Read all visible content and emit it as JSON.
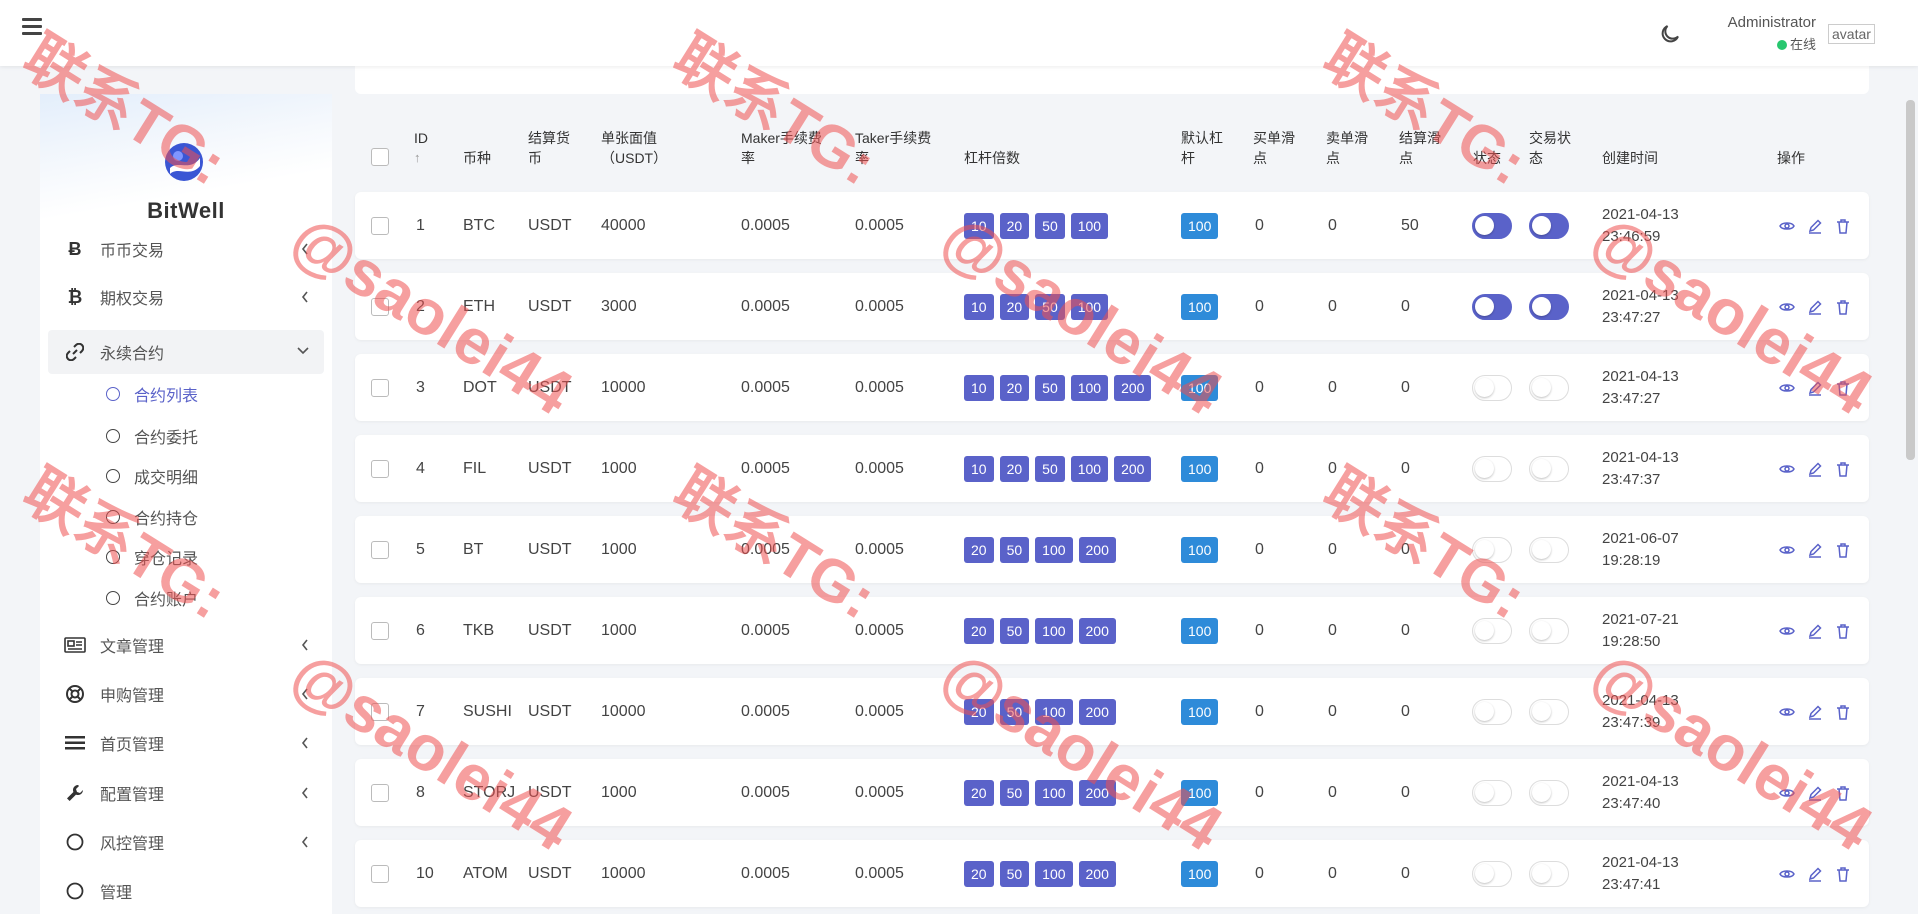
{
  "header": {
    "user_name": "Administrator",
    "user_status": "在线",
    "avatar_alt": "avatar"
  },
  "sidebar": {
    "brand": "BitWell",
    "items": [
      {
        "label": "币币交易",
        "icon": "bitcoin-icon",
        "top": 0
      },
      {
        "label": "期权交易",
        "icon": "bitcoin-icon"
      },
      {
        "label": "永续合约",
        "icon": "link-icon",
        "open": true
      },
      {
        "label": "文章管理",
        "icon": "newspaper-icon"
      },
      {
        "label": "申购管理",
        "icon": "lifebuoy-icon"
      },
      {
        "label": "首页管理",
        "icon": "list-icon"
      },
      {
        "label": "配置管理",
        "icon": "wrench-icon"
      },
      {
        "label": "风控管理",
        "icon": "circle-icon"
      },
      {
        "label": "管理",
        "icon": "circle-icon"
      }
    ],
    "sub_items": [
      "合约列表",
      "合约委托",
      "成交明细",
      "合约持仓",
      "穿仓记录",
      "合约账户"
    ]
  },
  "table": {
    "headers": {
      "id": "ID",
      "symbol": "币种",
      "settle": "结算货币",
      "face_value": "单张面值（USDT）",
      "maker": "Maker手续费率",
      "taker": "Taker手续费率",
      "leverage": "杠杆倍数",
      "default_leverage": "默认杠杆",
      "buy_slip": "买单滑点",
      "sell_slip": "卖单滑点",
      "settle_slip": "结算滑点",
      "status": "状态",
      "trade_status": "交易状态",
      "created": "创建时间",
      "ops": "操作"
    },
    "rows": [
      {
        "id": "1",
        "symbol": "BTC",
        "settle": "USDT",
        "face": "40000",
        "maker": "0.0005",
        "taker": "0.0005",
        "lev": [
          "10",
          "20",
          "50",
          "100"
        ],
        "def": "100",
        "buy": "0",
        "sell": "0",
        "settle_slip": "50",
        "status": true,
        "trade": true,
        "date": "2021-04-13",
        "time": "23:46:59"
      },
      {
        "id": "2",
        "symbol": "ETH",
        "settle": "USDT",
        "face": "3000",
        "maker": "0.0005",
        "taker": "0.0005",
        "lev": [
          "10",
          "20",
          "50",
          "100"
        ],
        "def": "100",
        "buy": "0",
        "sell": "0",
        "settle_slip": "0",
        "status": true,
        "trade": true,
        "date": "2021-04-13",
        "time": "23:47:27"
      },
      {
        "id": "3",
        "symbol": "DOT",
        "settle": "USDT",
        "face": "10000",
        "maker": "0.0005",
        "taker": "0.0005",
        "lev": [
          "10",
          "20",
          "50",
          "100",
          "200"
        ],
        "def": "100",
        "buy": "0",
        "sell": "0",
        "settle_slip": "0",
        "status": false,
        "trade": false,
        "date": "2021-04-13",
        "time": "23:47:27"
      },
      {
        "id": "4",
        "symbol": "FIL",
        "settle": "USDT",
        "face": "1000",
        "maker": "0.0005",
        "taker": "0.0005",
        "lev": [
          "10",
          "20",
          "50",
          "100",
          "200"
        ],
        "def": "100",
        "buy": "0",
        "sell": "0",
        "settle_slip": "0",
        "status": false,
        "trade": false,
        "date": "2021-04-13",
        "time": "23:47:37"
      },
      {
        "id": "5",
        "symbol": "BT",
        "settle": "USDT",
        "face": "1000",
        "maker": "0.0005",
        "taker": "0.0005",
        "lev": [
          "20",
          "50",
          "100",
          "200"
        ],
        "def": "100",
        "buy": "0",
        "sell": "0",
        "settle_slip": "0",
        "status": false,
        "trade": false,
        "date": "2021-06-07",
        "time": "19:28:19"
      },
      {
        "id": "6",
        "symbol": "TKB",
        "settle": "USDT",
        "face": "1000",
        "maker": "0.0005",
        "taker": "0.0005",
        "lev": [
          "20",
          "50",
          "100",
          "200"
        ],
        "def": "100",
        "buy": "0",
        "sell": "0",
        "settle_slip": "0",
        "status": false,
        "trade": false,
        "date": "2021-07-21",
        "time": "19:28:50"
      },
      {
        "id": "7",
        "symbol": "SUSHI",
        "settle": "USDT",
        "face": "10000",
        "maker": "0.0005",
        "taker": "0.0005",
        "lev": [
          "20",
          "50",
          "100",
          "200"
        ],
        "def": "100",
        "buy": "0",
        "sell": "0",
        "settle_slip": "0",
        "status": false,
        "trade": false,
        "date": "2021-04-13",
        "time": "23:47:39"
      },
      {
        "id": "8",
        "symbol": "STORJ",
        "settle": "USDT",
        "face": "1000",
        "maker": "0.0005",
        "taker": "0.0005",
        "lev": [
          "20",
          "50",
          "100",
          "200"
        ],
        "def": "100",
        "buy": "0",
        "sell": "0",
        "settle_slip": "0",
        "status": false,
        "trade": false,
        "date": "2021-04-13",
        "time": "23:47:40"
      },
      {
        "id": "10",
        "symbol": "ATOM",
        "settle": "USDT",
        "face": "10000",
        "maker": "0.0005",
        "taker": "0.0005",
        "lev": [
          "20",
          "50",
          "100",
          "200"
        ],
        "def": "100",
        "buy": "0",
        "sell": "0",
        "settle_slip": "0",
        "status": false,
        "trade": false,
        "date": "2021-04-13",
        "time": "23:47:41"
      }
    ]
  },
  "watermark": {
    "line1": "联系TG:",
    "line2": "@saolei44"
  },
  "colors": {
    "accent": "#5a62c9",
    "default_badge": "#2e8bd9",
    "online": "#28c76f",
    "watermark": "#ee5050"
  }
}
